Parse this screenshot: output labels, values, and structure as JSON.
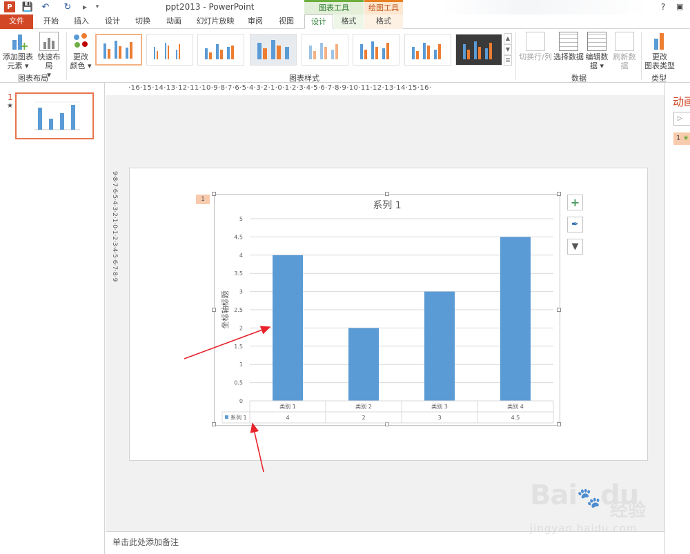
{
  "title_bar": {
    "app_logo": "P",
    "doc_title": "ppt2013 - PowerPoint",
    "context_group_chart": "图表工具",
    "context_group_draw": "绘图工具",
    "help": "?",
    "icons": [
      "save-icon",
      "undo-icon",
      "redo-icon",
      "present-from-start-icon",
      "customize-icon",
      "help-icon",
      "restore-icon"
    ]
  },
  "tabs": [
    "文件",
    "开始",
    "插入",
    "设计",
    "切换",
    "动画",
    "幻灯片放映",
    "审阅",
    "视图",
    "设计",
    "格式",
    "格式"
  ],
  "ribbon": {
    "add_element": [
      "添加图表",
      "元素"
    ],
    "quick_layout": "快速布局",
    "group_layout": "图表布局",
    "change_color": [
      "更改",
      "颜色"
    ],
    "group_styles": "图表样式",
    "switch_rowcol": "切换行/列",
    "select_data": "选择数据",
    "edit_data": [
      "编辑数",
      "据"
    ],
    "refresh_data": "刷新数据",
    "group_data": "数据",
    "change_type": [
      "更改",
      "图表类型"
    ],
    "group_type": "类型",
    "colors": {
      "accent_orange": "#d24726",
      "chart_blue": "#5b9bd5",
      "context_green": "#6cae3d",
      "context_orange": "#e87f22"
    }
  },
  "ruler": {
    "horizontal": "·16·15·14·13·12·11·10·9·8·7·6·5·4·3·2·1·0·1·2·3·4·5·6·7·8·9·10·11·12·13·14·15·16·",
    "vertical": "9·8·7·6·5·4·3·2·1·0·1·2·3·4·5·6·7·8·9"
  },
  "slides_pane": {
    "number": "1",
    "star": "★"
  },
  "animation_pane": {
    "title": "动画",
    "item": "1"
  },
  "anim_tag": "1",
  "notes": "单击此处添加备注",
  "chart_data": {
    "type": "bar",
    "title": "系列 1",
    "ylabel": "坐标轴标题",
    "categories": [
      "类别 1",
      "类别 2",
      "类别 3",
      "类别 4"
    ],
    "series": [
      {
        "name": "系列 1",
        "values": [
          4,
          2,
          3,
          4.5
        ]
      }
    ],
    "ylim": [
      0,
      5
    ],
    "yticks": [
      "0",
      "0.5",
      "1",
      "1.5",
      "2",
      "2.5",
      "3",
      "3.5",
      "4",
      "4.5",
      "5"
    ],
    "table_values": [
      "4",
      "2",
      "3",
      "4.5"
    ],
    "grid": true,
    "color": "#5b9bd5"
  },
  "watermark": {
    "logo": "Bai",
    "logo_b": "du",
    "cn": "经验",
    "url": "jingyan.baidu.com"
  }
}
